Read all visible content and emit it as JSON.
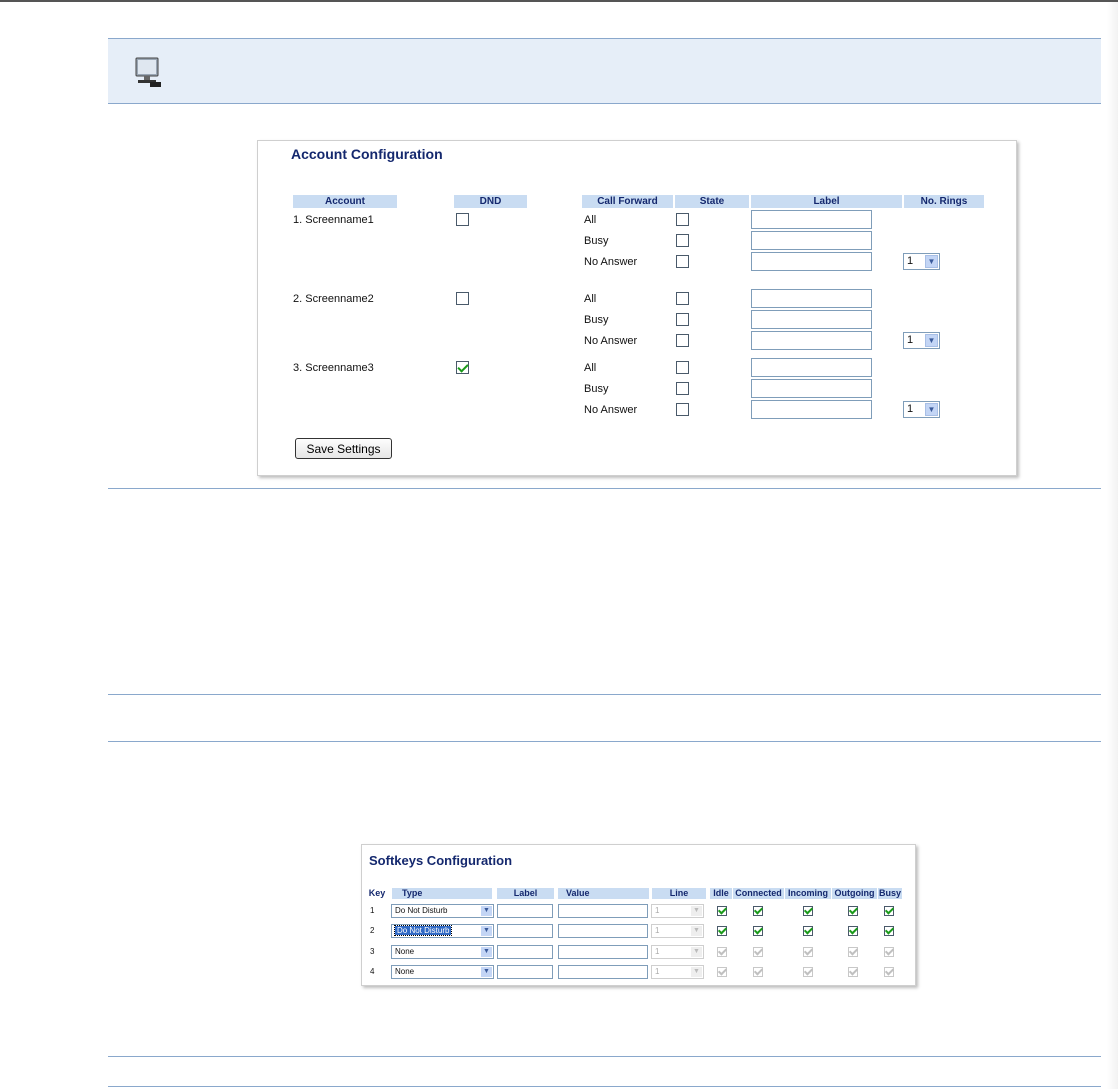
{
  "account_config": {
    "title": "Account Configuration",
    "headers": {
      "account": "Account",
      "dnd": "DND",
      "call_forward": "Call Forward",
      "state": "State",
      "label": "Label",
      "rings": "No. Rings"
    },
    "accounts": [
      {
        "name": "1. Screenname1",
        "dnd": false,
        "rows": [
          {
            "type": "All",
            "state": false,
            "label": ""
          },
          {
            "type": "Busy",
            "state": false,
            "label": ""
          },
          {
            "type": "No Answer",
            "state": false,
            "label": "",
            "rings": "1"
          }
        ]
      },
      {
        "name": "2. Screenname2",
        "dnd": false,
        "rows": [
          {
            "type": "All",
            "state": false,
            "label": ""
          },
          {
            "type": "Busy",
            "state": false,
            "label": ""
          },
          {
            "type": "No Answer",
            "state": false,
            "label": "",
            "rings": "1"
          }
        ]
      },
      {
        "name": "3. Screenname3",
        "dnd": true,
        "rows": [
          {
            "type": "All",
            "state": false,
            "label": ""
          },
          {
            "type": "Busy",
            "state": false,
            "label": ""
          },
          {
            "type": "No Answer",
            "state": false,
            "label": "",
            "rings": "1"
          }
        ]
      }
    ],
    "save_label": "Save Settings"
  },
  "softkeys_config": {
    "title": "Softkeys Configuration",
    "headers": {
      "key": "Key",
      "type": "Type",
      "label": "Label",
      "value": "Value",
      "line": "Line",
      "idle": "Idle",
      "connected": "Connected",
      "incoming": "Incoming",
      "outgoing": "Outgoing",
      "busy": "Busy"
    },
    "rows": [
      {
        "key": "1",
        "type": "Do Not Disturb",
        "line": "1",
        "idle": true,
        "connected": true,
        "incoming": true,
        "outgoing": true,
        "busy": true,
        "enabled": true
      },
      {
        "key": "2",
        "type": "Do Not Disturb",
        "line": "1",
        "idle": true,
        "connected": true,
        "incoming": true,
        "outgoing": true,
        "busy": true,
        "enabled": true,
        "focused": true
      },
      {
        "key": "3",
        "type": "None",
        "line": "1",
        "idle": true,
        "connected": true,
        "incoming": true,
        "outgoing": true,
        "busy": true,
        "enabled": false
      },
      {
        "key": "4",
        "type": "None",
        "line": "1",
        "idle": true,
        "connected": true,
        "incoming": true,
        "outgoing": true,
        "busy": true,
        "enabled": false
      }
    ]
  },
  "colors": {
    "header_fill": "#c9dcf2",
    "title_text": "#14286e",
    "band_fill": "#e6eef8",
    "rule": "#8aa8cc",
    "check": "#1a9a1a"
  },
  "icons": {
    "band_icon": "computer-monitor-icon",
    "dropdown": "chevron-down-icon"
  }
}
